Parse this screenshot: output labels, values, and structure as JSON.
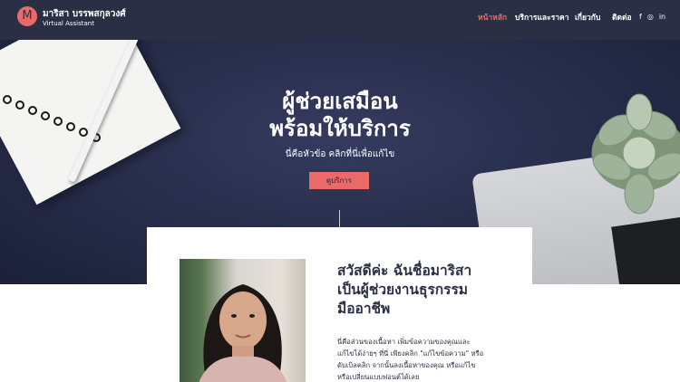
{
  "header": {
    "logo_letter": "M",
    "brand_name": "มาริสา บรรพสกุลวงศ์",
    "brand_subtitle": "Virtual Assistant",
    "nav": [
      {
        "label": "หน้าหลัก",
        "active": true
      },
      {
        "label": "บริการและราคา",
        "active": false
      },
      {
        "label": "เกี่ยวกับ",
        "active": false
      },
      {
        "label": "ติดต่อ",
        "active": false
      }
    ],
    "social_icons": [
      "facebook-icon",
      "instagram-icon",
      "linkedin-icon"
    ],
    "social_glyphs": [
      "f",
      "◎",
      "in"
    ]
  },
  "hero": {
    "title_line1": "ผู้ช่วยเสมือน",
    "title_line2": "พร้อมให้บริการ",
    "subtitle": "นี่คือหัวข้อ คลิกที่นี่เพื่อแก้ไข",
    "button_label": "ดูบริการ"
  },
  "about": {
    "title_line1": "สวัสดีค่ะ ฉันชื่อมาริสา",
    "title_line2": "เป็นผู้ช่วยงานธุรกรรม",
    "title_line3": "มืออาชีพ",
    "body_line1": "นี่คือส่วนของเนื้อหา เพิ่มข้อความของคุณและ",
    "body_line2": "แก้ไขได้ง่ายๆ ที่นี่ เพียงคลิก \"แก้ไขข้อความ\" หรือ",
    "body_line3": "ดับเบิลคลิก จากนั้นลงเนื้อหาของคุณ หรือแก้ไข",
    "body_line4": "หรือเปลี่ยนแบบฟอนต์ได้เลย"
  },
  "colors": {
    "navy": "#2a2f45",
    "accent": "#ea6a67",
    "white": "#ffffff"
  }
}
